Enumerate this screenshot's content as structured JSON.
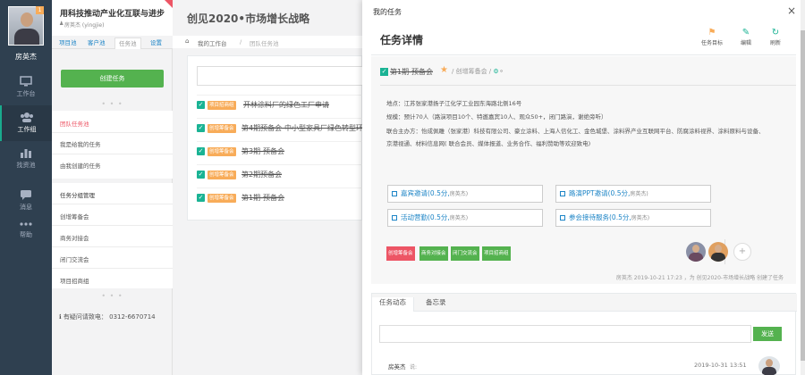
{
  "nav": {
    "badge": "1",
    "username": "房英杰",
    "items": [
      {
        "label": "工作台",
        "icon": "monitor-icon"
      },
      {
        "label": "工作组",
        "icon": "group-icon"
      },
      {
        "label": "找资池",
        "icon": "chart-icon"
      },
      {
        "label": "消息",
        "icon": "chat-icon"
      },
      {
        "label": "帮助",
        "icon": "more-icon"
      }
    ]
  },
  "sub": {
    "title": "用科技推动产业化互联与进步",
    "user": "房英杰 (yingjie)",
    "tabs": [
      "项目池",
      "客户池",
      "任务池",
      "设置"
    ],
    "new_task": "创建任务",
    "task_pool": "团队任务池",
    "items1": [
      "我是给我的任务",
      "由我创建的任务"
    ],
    "group_title": "任务分组管理",
    "groups": [
      "创增筹备会",
      "商务对接会",
      "闭门交流会",
      "项目招商组"
    ],
    "help": "有疑问请致电： 0312-6670714"
  },
  "main": {
    "title": "创见2020•市场增长战略",
    "breadcrumb": {
      "home": "我的工作台",
      "sep": "/",
      "current": "团队任务池"
    },
    "tasks": [
      {
        "badge": "项目招商组",
        "title": "开林涂料厂的绿色工厂申请"
      },
      {
        "badge": "创增筹备会",
        "title": "第4期预备会-中小型家具厂绿色转型环"
      },
      {
        "badge": "创增筹备会",
        "title": "第3期-预备会"
      },
      {
        "badge": "创增筹备会",
        "title": "第2期预备会"
      },
      {
        "badge": "创增筹备会",
        "title": "第1期-预备会"
      }
    ]
  },
  "panel": {
    "title": "我的任务",
    "close": "×",
    "detail_title": "任务详情",
    "toolbar": [
      {
        "label": "任务目标",
        "icon": "flag-icon",
        "color": "#f8ac59",
        "glyph": "⚑"
      },
      {
        "label": "编辑",
        "icon": "edit-icon",
        "color": "#1ab394",
        "glyph": "✎"
      },
      {
        "label": "刷新",
        "icon": "refresh-icon",
        "color": "#1ab394",
        "glyph": "↻"
      }
    ],
    "path": {
      "name": "第1期-预备会",
      "sub": "/ 创增筹备会 /"
    },
    "info": [
      "地点：江苏张家港扬子江化学工业园东海路北侧16号",
      "规模：预计70人（路演项目10个、特邀嘉宾10人、观众50+，闭门路演，谢绝旁听）",
      "联合主办方：怡成佩雕（张家港）科技有限公司、豪立涂料、上海人信化工、金色城堡、涂料界产业互联网平台、防腐涂料视界、涂料原料与设备、",
      "京港视通、材料信息网( 联合会员、媒体报道、业务合作、福利赞助等欢迎致电)"
    ],
    "subtasks": [
      {
        "label": "嘉宾邀请(0.5分,",
        "owner": "房英杰)"
      },
      {
        "label": "路演PPT邀请(0.5分,",
        "owner": "房英杰)"
      },
      {
        "label": "活动营勤(0.5分,",
        "owner": "房英杰)"
      },
      {
        "label": "参会接待服务(0.5分,",
        "owner": "房英杰)"
      }
    ],
    "tags": [
      {
        "label": "创增筹备会",
        "color": "#ed5565"
      },
      {
        "label": "商务对接会",
        "color": "#54b24f"
      },
      {
        "label": "闭门交流会",
        "color": "#54b24f"
      },
      {
        "label": "项目招商组",
        "color": "#54b24f"
      }
    ],
    "add_member": "+",
    "created": "房英杰 2019-10-21 17:23 ，为 创见2020-市场增长战略 创建了任务",
    "activity_tabs": [
      "任务动态",
      "备忘录"
    ],
    "send": "发送",
    "comment": {
      "user": "房英杰",
      "said": "说:",
      "time": "2019-10-31 13:51"
    }
  }
}
